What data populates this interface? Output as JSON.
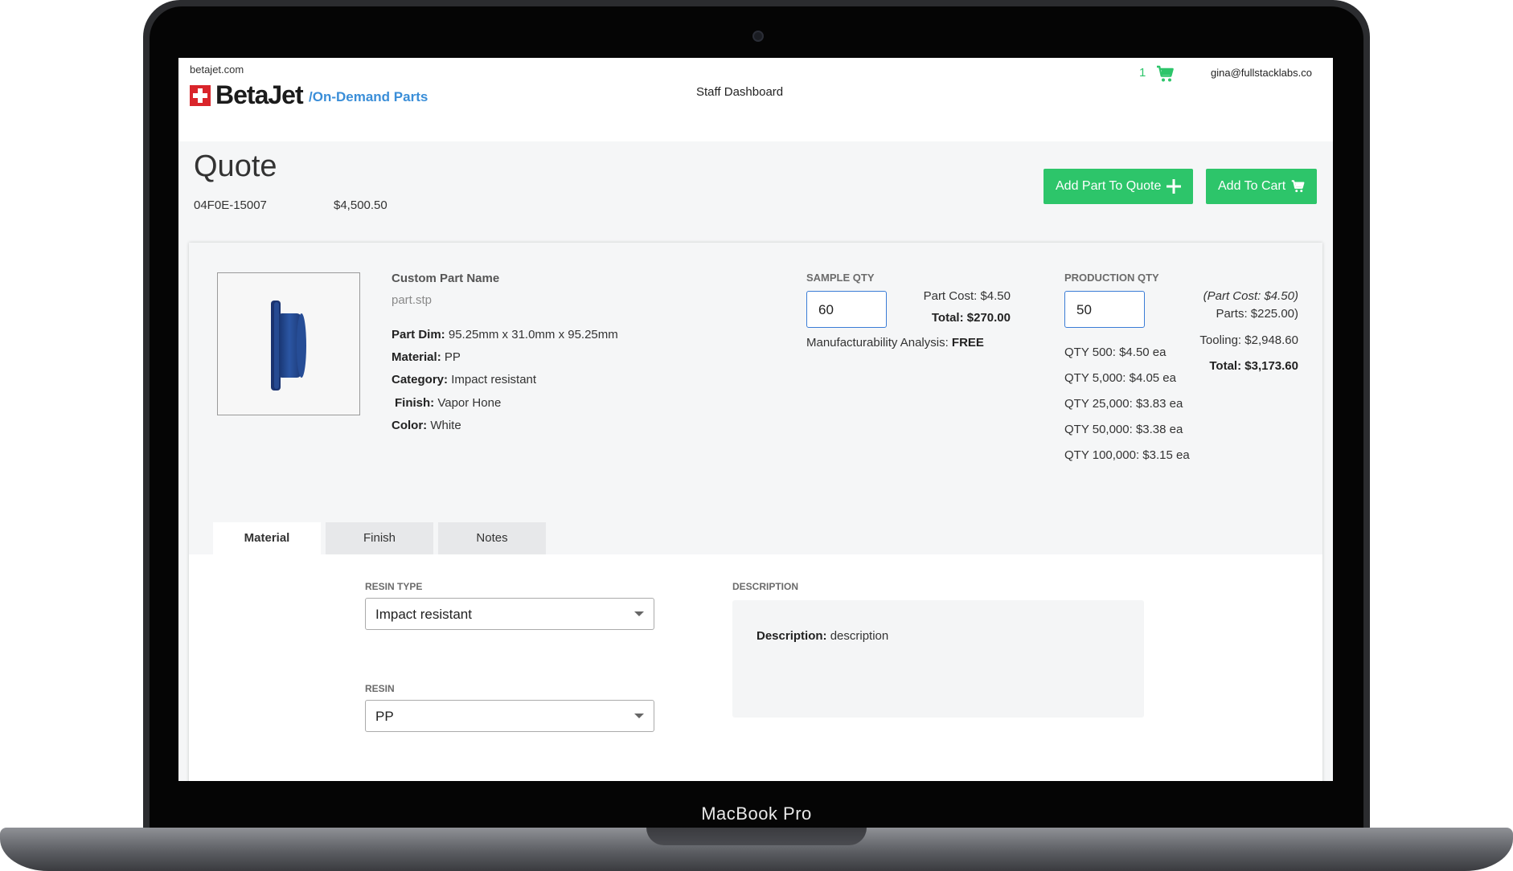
{
  "device": {
    "label": "MacBook Pro"
  },
  "header": {
    "site_url": "betajet.com",
    "logo_text": "BetaJet",
    "logo_subtitle": "/On-Demand Parts",
    "nav_center": "Staff Dashboard",
    "cart_count": "1",
    "user_email": "gina@fullstacklabs.co"
  },
  "quote": {
    "title": "Quote",
    "id": "04F0E-15007",
    "total": "$4,500.50",
    "add_part_label": "Add Part To Quote",
    "add_cart_label": "Add To Cart"
  },
  "part": {
    "name": "Custom Part Name",
    "file": "part.stp",
    "specs": [
      {
        "label": "Part Dim:",
        "value": "95.25mm x 31.0mm x 95.25mm"
      },
      {
        "label": "Material:",
        "value": "PP"
      },
      {
        "label": "Category:",
        "value": "Impact resistant"
      },
      {
        "label": "Finish:",
        "value": "Vapor Hone"
      },
      {
        "label": "Color:",
        "value": "White"
      }
    ]
  },
  "sample": {
    "label": "SAMPLE QTY",
    "qty": "60",
    "part_cost": "Part Cost: $4.50",
    "total_label": "Total:",
    "total_value": "$270.00",
    "analysis_label": "Manufacturability Analysis:",
    "analysis_value": "FREE"
  },
  "production": {
    "label": "PRODUCTION QTY",
    "qty": "50",
    "tiers": [
      "QTY 500: $4.50 ea",
      "QTY 5,000: $4.05 ea",
      "QTY 25,000: $3.83 ea",
      "QTY 50,000: $3.38 ea",
      "QTY 100,000: $3.15 ea"
    ],
    "part_cost": "(Part Cost: $4.50)",
    "parts": "Parts: $225.00)",
    "tooling": "Tooling: $2,948.60",
    "total_label": "Total:",
    "total_value": "$3,173.60"
  },
  "tabs": [
    {
      "label": "Material"
    },
    {
      "label": "Finish"
    },
    {
      "label": "Notes"
    }
  ],
  "material": {
    "resin_type_label": "RESIN TYPE",
    "resin_type_value": "Impact resistant",
    "resin_label": "RESIN",
    "resin_value": "PP",
    "description_header": "DESCRIPTION",
    "description_label": "Description:",
    "description_value": "description"
  },
  "colors": {
    "accent": "#2dc56a",
    "link": "#3a8ed8",
    "brand_red": "#d9252b",
    "input_border": "#3a7cd6",
    "part_blue": "#1f3f7a"
  },
  "icons": [
    "cart-icon",
    "plus-icon",
    "dropdown-caret-icon"
  ]
}
